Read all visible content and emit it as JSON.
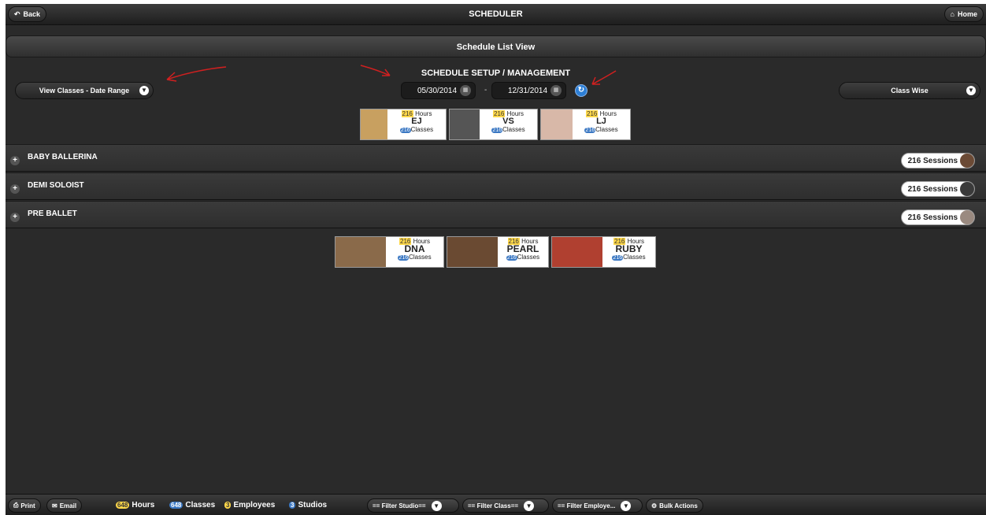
{
  "header": {
    "title": "SCHEDULER",
    "back_label": "Back",
    "home_label": "Home"
  },
  "subheader": {
    "title": "Schedule List View"
  },
  "setup": {
    "title": "SCHEDULE SETUP / MANAGEMENT",
    "view_select": "View Classes - Date Range",
    "start_date": "05/30/2014",
    "date_separator": "-",
    "end_date": "12/31/2014",
    "group_select": "Class Wise"
  },
  "employees": [
    {
      "hours": "216",
      "hours_label": "Hours",
      "code": "EJ",
      "classes": "216",
      "classes_label": "Classes",
      "photo_color": "#c8a060"
    },
    {
      "hours": "216",
      "hours_label": "Hours",
      "code": "VS",
      "classes": "216",
      "classes_label": "Classes",
      "photo_color": "#555555"
    },
    {
      "hours": "216",
      "hours_label": "Hours",
      "code": "LJ",
      "classes": "216",
      "classes_label": "Classes",
      "photo_color": "#d8b8a8"
    }
  ],
  "class_rows": [
    {
      "name": "BABY BALLERINA",
      "sessions": "216 Sessions",
      "face_color": "#6b4a35"
    },
    {
      "name": "DEMI SOLOIST",
      "sessions": "216 Sessions",
      "face_color": "#3a3a3a"
    },
    {
      "name": "PRE BALLET",
      "sessions": "216 Sessions",
      "face_color": "#9a8a80"
    }
  ],
  "studios": [
    {
      "hours": "216",
      "hours_label": "Hours",
      "code": "DNA",
      "classes": "216",
      "classes_label": "Classes",
      "photo_color": "#8a6a4a"
    },
    {
      "hours": "216",
      "hours_label": "Hours",
      "code": "PEARL",
      "classes": "216",
      "classes_label": "Classes",
      "photo_color": "#6a4a32"
    },
    {
      "hours": "216",
      "hours_label": "Hours",
      "code": "RUBY",
      "classes": "216",
      "classes_label": "Classes",
      "photo_color": "#b04030"
    }
  ],
  "footer": {
    "print_label": "Print",
    "email_label": "Email",
    "hours_count": "648",
    "hours_label": "Hours",
    "classes_count": "648",
    "classes_label": "Classes",
    "employees_count": "3",
    "employees_label": "Employees",
    "studios_count": "3",
    "studios_label": "Studios",
    "filter_studio": "== Filter Studio==",
    "filter_class": "== Filter Class==",
    "filter_employee": "== Filter Employe...",
    "bulk_actions": "Bulk Actions"
  }
}
